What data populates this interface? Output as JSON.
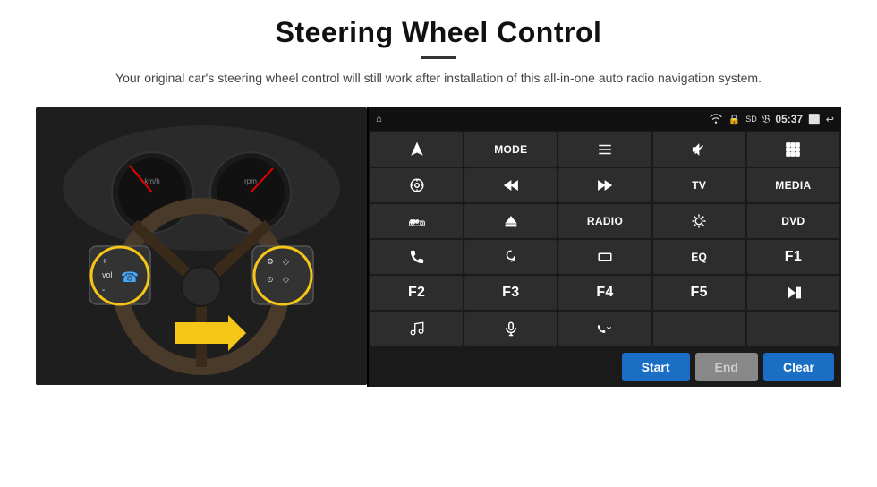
{
  "header": {
    "title": "Steering Wheel Control",
    "subtitle": "Your original car's steering wheel control will still work after installation of this all-in-one auto radio navigation system."
  },
  "statusBar": {
    "time": "05:37",
    "icons": [
      "wifi",
      "lock",
      "sd",
      "bluetooth",
      "cast",
      "back"
    ]
  },
  "buttons": [
    {
      "id": "r1c1",
      "type": "icon",
      "icon": "navigate",
      "label": ""
    },
    {
      "id": "r1c2",
      "type": "text",
      "label": "MODE"
    },
    {
      "id": "r1c3",
      "type": "icon",
      "icon": "list"
    },
    {
      "id": "r1c4",
      "type": "icon",
      "icon": "mute"
    },
    {
      "id": "r1c5",
      "type": "icon",
      "icon": "dots-grid"
    },
    {
      "id": "r2c1",
      "type": "icon",
      "icon": "settings-circle"
    },
    {
      "id": "r2c2",
      "type": "icon",
      "icon": "rewind"
    },
    {
      "id": "r2c3",
      "type": "icon",
      "icon": "fast-forward"
    },
    {
      "id": "r2c4",
      "type": "text",
      "label": "TV"
    },
    {
      "id": "r2c5",
      "type": "text",
      "label": "MEDIA"
    },
    {
      "id": "r3c1",
      "type": "icon",
      "icon": "car-360"
    },
    {
      "id": "r3c2",
      "type": "icon",
      "icon": "eject"
    },
    {
      "id": "r3c3",
      "type": "text",
      "label": "RADIO"
    },
    {
      "id": "r3c4",
      "type": "icon",
      "icon": "brightness"
    },
    {
      "id": "r3c5",
      "type": "text",
      "label": "DVD"
    },
    {
      "id": "r4c1",
      "type": "icon",
      "icon": "phone"
    },
    {
      "id": "r4c2",
      "type": "icon",
      "icon": "swirl"
    },
    {
      "id": "r4c3",
      "type": "icon",
      "icon": "rectangle"
    },
    {
      "id": "r4c4",
      "type": "text",
      "label": "EQ"
    },
    {
      "id": "r4c5",
      "type": "text",
      "label": "F1"
    },
    {
      "id": "r5c1",
      "type": "text",
      "label": "F2"
    },
    {
      "id": "r5c2",
      "type": "text",
      "label": "F3"
    },
    {
      "id": "r5c3",
      "type": "text",
      "label": "F4"
    },
    {
      "id": "r5c4",
      "type": "text",
      "label": "F5"
    },
    {
      "id": "r5c5",
      "type": "icon",
      "icon": "play-pause"
    },
    {
      "id": "r6c1",
      "type": "icon",
      "icon": "music"
    },
    {
      "id": "r6c2",
      "type": "icon",
      "icon": "microphone"
    },
    {
      "id": "r6c3",
      "type": "icon",
      "icon": "phone-sound"
    },
    {
      "id": "r6c4",
      "type": "text",
      "label": ""
    },
    {
      "id": "r6c5",
      "type": "text",
      "label": ""
    }
  ],
  "actionBar": {
    "startLabel": "Start",
    "endLabel": "End",
    "clearLabel": "Clear"
  }
}
